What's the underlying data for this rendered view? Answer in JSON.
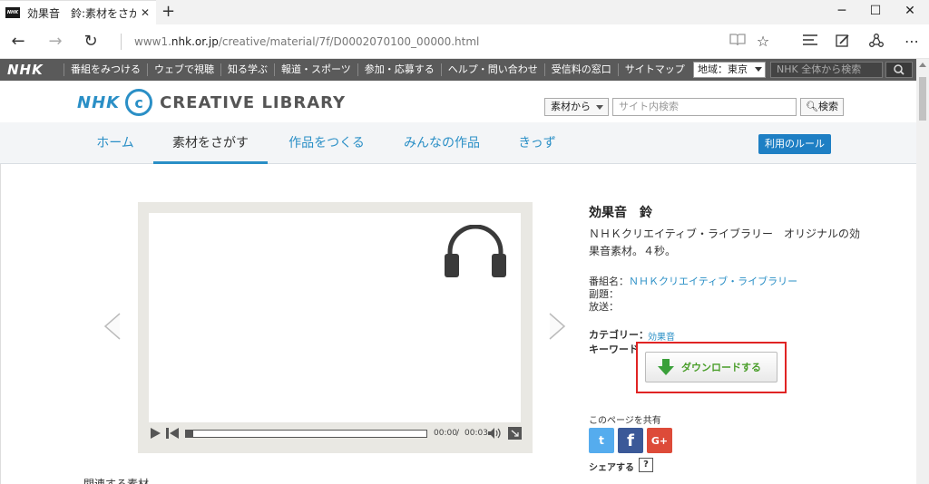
{
  "browser": {
    "tab_title": "効果音　鈴:素材をさがす",
    "url_prefix": "www1.",
    "url_host": "nhk.or.jp",
    "url_path": "/creative/material/7f/D0002070100_00000.html"
  },
  "nhk_header": {
    "logo": "NHK",
    "nav": [
      "番組をみつける",
      "ウェブで視聴",
      "知る学ぶ",
      "報道・スポーツ",
      "参加・応募する",
      "ヘルプ・問い合わせ",
      "受信料の窓口",
      "サイトマップ"
    ],
    "region": "地域：東京",
    "search_placeholder": "NHK 全体から検索"
  },
  "site_header": {
    "logo_nhk": "NHK",
    "logo_c": "c",
    "logo_text": "CREATIVE LIBRARY",
    "search_scope": "素材から",
    "search_placeholder": "サイト内検索",
    "search_button": "検索"
  },
  "site_nav": {
    "items": [
      "ホーム",
      "素材をさがす",
      "作品をつくる",
      "みんなの作品",
      "きっず"
    ],
    "active_index": 1,
    "rules_button": "利用のルール"
  },
  "player": {
    "time_current": "00:00",
    "time_separator": "/",
    "time_duration": "00:03",
    "progress": 0.03
  },
  "material": {
    "title": "効果音　鈴",
    "description": "ＮＨＫクリエイティブ・ライブラリー　オリジナルの効果音素材。４秒。",
    "program_label": "番組名：",
    "program_value": "ＮＨＫクリエイティブ・ライブラリー",
    "subtitle_label": "副題：",
    "broadcast_label": "放送：",
    "category_label": "カテゴリー：",
    "category_value": "効果音",
    "keyword_label": "キーワード",
    "download_button": "ダウンロードする"
  },
  "share": {
    "title": "このページを共有",
    "twitter": "t",
    "facebook": "f",
    "google": "G+",
    "label": "シェアする",
    "help": "?"
  },
  "related": {
    "heading": "関連する素材"
  },
  "colors": {
    "accent": "#2a8fc6",
    "nhk_bar": "#5a5a5a",
    "download_green": "#4a9e2a",
    "highlight_red": "#e02424",
    "twitter": "#55acee",
    "facebook": "#3b5998",
    "google": "#dd4b39"
  }
}
